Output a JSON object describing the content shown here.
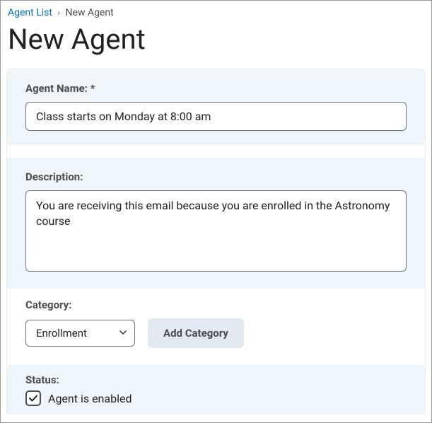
{
  "breadcrumb": {
    "parent": "Agent List",
    "current": "New Agent"
  },
  "page_title": "New Agent",
  "agent_name": {
    "label": "Agent Name: *",
    "value": "Class starts on Monday at 8:00 am"
  },
  "description": {
    "label": "Description:",
    "value": "You are receiving this email because you are enrolled in the Astronomy course"
  },
  "category": {
    "label": "Category:",
    "selected": "Enrollment",
    "add_button": "Add Category"
  },
  "status": {
    "label": "Status:",
    "checkbox_label": "Agent is enabled",
    "checked": true
  }
}
